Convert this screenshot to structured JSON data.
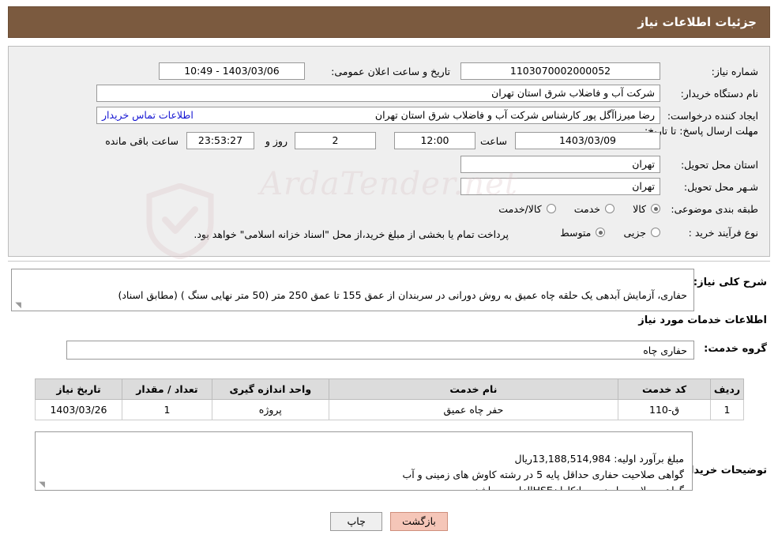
{
  "header": {
    "title": "جزئیات اطلاعات نیاز"
  },
  "form": {
    "need_number_label": "شماره نیاز:",
    "need_number_value": "1103070002000052",
    "announce_datetime_label": "تاریخ و ساعت اعلان عمومی:",
    "announce_datetime_value": "1403/03/06 - 10:49",
    "buyer_org_label": "نام دستگاه خریدار:",
    "buyer_org_value": "شرکت آب و فاضلاب شرق استان تهران",
    "requester_label": "ایجاد کننده درخواست:",
    "requester_value": "رضا میرزاآگل پور کارشناس شرکت آب و فاضلاب شرق استان تهران",
    "buyer_contact_link": "اطلاعات تماس خریدار",
    "deadline_label": "مهلت ارسال پاسخ: تا تاریخ:",
    "deadline_date": "1403/03/09",
    "hour_label": "ساعت",
    "deadline_time": "12:00",
    "days_value": "2",
    "days_label": "روز و",
    "countdown_value": "23:53:27",
    "remaining_label": "ساعت باقی مانده",
    "province_label": "استان محل تحویل:",
    "province_value": "تهران",
    "city_label": "شـهر محل تحویل:",
    "city_value": "تهران",
    "category_label": "طبقه بندی موضوعی:",
    "category_options": [
      {
        "label": "کالا",
        "selected": true
      },
      {
        "label": "خدمت",
        "selected": false
      },
      {
        "label": "کالا/خدمت",
        "selected": false
      }
    ],
    "process_label": "نوع فرآیند خرید :",
    "process_options": [
      {
        "label": "جزیی",
        "selected": false
      },
      {
        "label": "متوسط",
        "selected": true
      }
    ],
    "process_note": "پرداخت تمام یا بخشی از مبلغ خرید،از محل \"اسناد خزانه اسلامی\" خواهد بود."
  },
  "description": {
    "label": "شرح کلی نیاز:",
    "value": "حفاری، آزمایش آبدهی یک حلقه چاه عمیق به روش دورانی در سربندان از عمق 155 تا عمق 250 متر (50 متر نهایی سنگ ) (مطابق اسناد)"
  },
  "services_section_title": "اطلاعات خدمات مورد نیاز",
  "service_group": {
    "label": "گروه خدمت:",
    "value": "حفاری چاه"
  },
  "table": {
    "headers": [
      "ردیف",
      "کد خدمت",
      "نام خدمت",
      "واحد اندازه گیری",
      "تعداد / مقدار",
      "تاریخ نیاز"
    ],
    "rows": [
      [
        "1",
        "ق-110",
        "حفر چاه عمیق",
        "پروژه",
        "1",
        "1403/03/26"
      ]
    ]
  },
  "buyer_notes": {
    "label": "توضیحات خریدار:",
    "value": "مبلغ برآورد اولیه: 13,188,514,984ریال\nگواهی صلاحیت حفاری حداقل پایه 5 در رشته کاوش های زمینی و آب\nگواهی صلاحیت ایمنی پیمانکارانHSEالزامی میباشد."
  },
  "buttons": {
    "print": "چاپ",
    "back": "بازگشت"
  },
  "watermark": {
    "text": "ArdaTender.net"
  }
}
